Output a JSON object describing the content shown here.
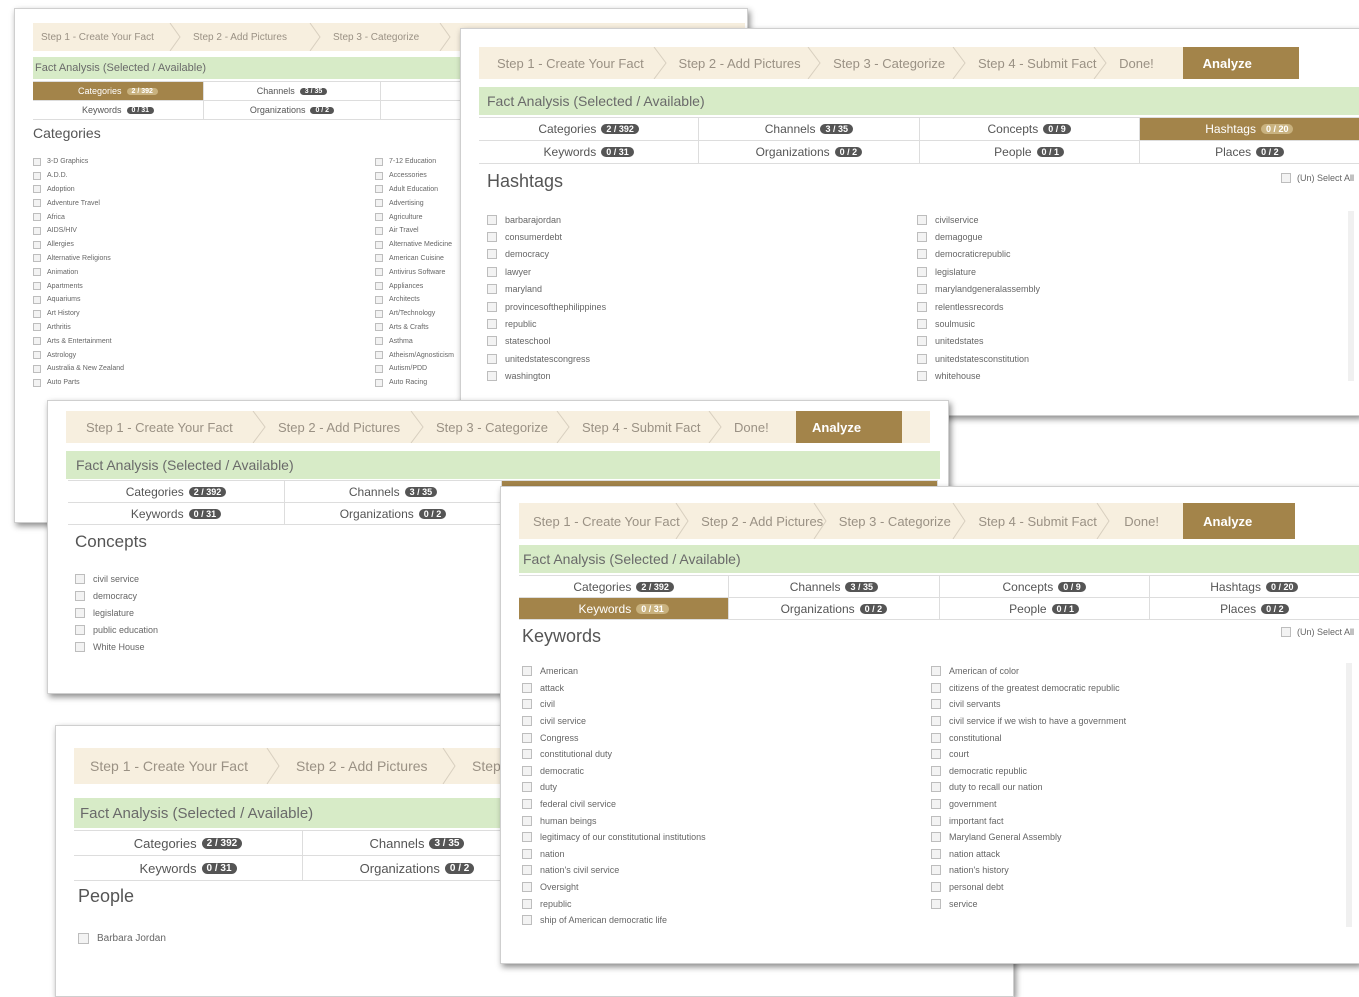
{
  "steps": {
    "step1": "Step 1 - Create Your Fact",
    "step2": "Step 2 - Add Pictures",
    "step3": "Step 3 - Categorize",
    "step4": "Step 4 - Submit Fact",
    "done": "Done!",
    "analyze": "Analyze"
  },
  "fact_analysis_title": "Fact Analysis (Selected / Available)",
  "tabs": {
    "categories": {
      "label": "Categories",
      "count": "2 / 392"
    },
    "channels": {
      "label": "Channels",
      "count": "3 / 35"
    },
    "concepts": {
      "label": "Concepts",
      "count": "0 / 9"
    },
    "hashtags": {
      "label": "Hashtags",
      "count": "0 / 20"
    },
    "keywords": {
      "label": "Keywords",
      "count": "0 / 31"
    },
    "organizations": {
      "label": "Organizations",
      "count": "0 / 2"
    },
    "people": {
      "label": "People",
      "count": "0 / 1"
    },
    "places": {
      "label": "Places",
      "count": "0 / 2"
    }
  },
  "select_all_label": "(Un) Select All",
  "categories_panel": {
    "title": "Categories",
    "col1": [
      "3-D Graphics",
      "A.D.D.",
      "Adoption",
      "Adventure Travel",
      "Africa",
      "AIDS/HIV",
      "Allergies",
      "Alternative Religions",
      "Animation",
      "Apartments",
      "Aquariums",
      "Art History",
      "Arthritis",
      "Arts & Entertainment",
      "Astrology",
      "Australia & New Zealand",
      "Auto Parts"
    ],
    "col2": [
      "7-12 Education",
      "Accessories",
      "Adult Education",
      "Advertising",
      "Agriculture",
      "Air Travel",
      "Alternative Medicine",
      "American Cuisine",
      "Antivirus Software",
      "Appliances",
      "Architects",
      "Art/Technology",
      "Arts & Crafts",
      "Asthma",
      "Atheism/Agnosticism",
      "Autism/PDD",
      "Auto Racing"
    ]
  },
  "hashtags_panel": {
    "title": "Hashtags",
    "col1": [
      "barbarajordan",
      "consumerdebt",
      "democracy",
      "lawyer",
      "maryland",
      "provincesofthephilippines",
      "republic",
      "stateschool",
      "unitedstatescongress",
      "washington"
    ],
    "col2": [
      "civilservice",
      "demagogue",
      "democraticrepublic",
      "legislature",
      "marylandgeneralassembly",
      "relentlessrecords",
      "soulmusic",
      "unitedstates",
      "unitedstatesconstitution",
      "whitehouse"
    ]
  },
  "concepts_panel": {
    "title": "Concepts",
    "col1": [
      "civil service",
      "democracy",
      "legislature",
      "public education",
      "White House"
    ]
  },
  "keywords_panel": {
    "title": "Keywords",
    "col1": [
      "American",
      "attack",
      "civil",
      "civil service",
      "Congress",
      "constitutional duty",
      "democratic",
      "duty",
      "federal civil service",
      "human beings",
      "legitimacy of our constitutional institutions",
      "nation",
      "nation's civil service",
      "Oversight",
      "republic",
      "ship of American democratic life"
    ],
    "col2": [
      "American of color",
      "citizens of the greatest democratic republic",
      "civil servants",
      "civil service if we wish to have a government",
      "constitutional",
      "court",
      "democratic republic",
      "duty to recall our nation",
      "government",
      "important fact",
      "Maryland General Assembly",
      "nation attack",
      "nation's history",
      "personal debt",
      "service"
    ]
  },
  "people_panel": {
    "title": "People",
    "col1": [
      "Barbara Jordan"
    ]
  },
  "colors": {
    "accent": "#a3844a",
    "step_bg": "#f7efdf",
    "fact_bar": "#d7ebc7",
    "badge": "#555555"
  }
}
